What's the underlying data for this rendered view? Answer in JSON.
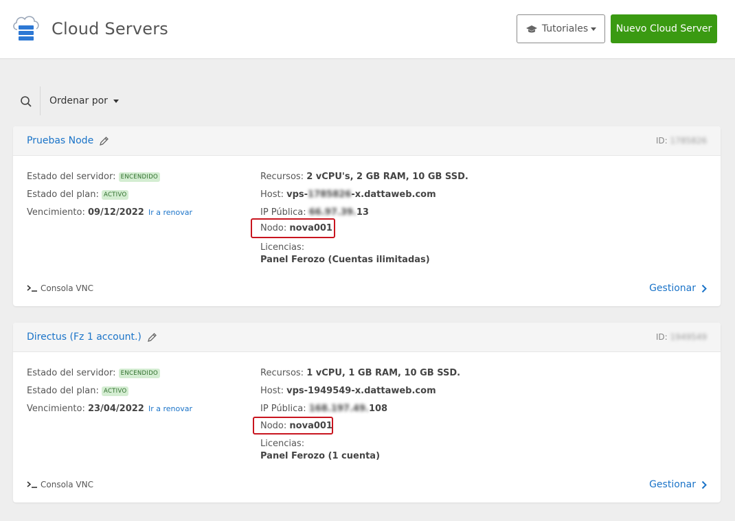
{
  "header": {
    "title": "Cloud Servers",
    "tutorials_label": "Tutoriales",
    "new_server_label": "Nuevo Cloud Server"
  },
  "toolbar": {
    "sort_label": "Ordenar por"
  },
  "labels": {
    "server_state": "Estado del servidor:",
    "plan_state": "Estado del plan:",
    "expiry": "Vencimiento:",
    "renew": "Ir a renovar",
    "resources": "Recursos:",
    "host": "Host:",
    "public_ip": "IP Pública:",
    "node": "Nodo:",
    "licenses": "Licencias:",
    "vnc": "Consola VNC",
    "manage": "Gestionar",
    "id": "ID:"
  },
  "servers": [
    {
      "name": "Pruebas Node",
      "id": "1785826",
      "server_status": "ENCENDIDO",
      "plan_status": "ACTIVO",
      "expiry": "09/12/2022",
      "resources": "2 vCPU's, 2 GB RAM, 10 GB SSD.",
      "host_prefix": "vps-",
      "host_hidden": "1785826",
      "host_suffix": "-x.dattaweb.com",
      "ip_hidden": "66.97.39.",
      "ip_suffix": "13",
      "node": "nova001",
      "license": "Panel Ferozo (Cuentas ilimitadas)"
    },
    {
      "name": "Directus (Fz 1 account.)",
      "id": "1949549",
      "server_status": "ENCENDIDO",
      "plan_status": "ACTIVO",
      "expiry": "23/04/2022",
      "resources": "1 vCPU, 1 GB RAM, 10 GB SSD.",
      "host": "vps-1949549-x.dattaweb.com",
      "ip_hidden": "168.197.49.",
      "ip_suffix": "108",
      "node": "nova001",
      "license": "Panel Ferozo (1 cuenta)"
    }
  ],
  "colors": {
    "accent_blue": "#1a73c8",
    "new_button_green": "#3a9a12",
    "highlight_red": "#c8141e",
    "status_badge_bg": "#d4edd2"
  }
}
